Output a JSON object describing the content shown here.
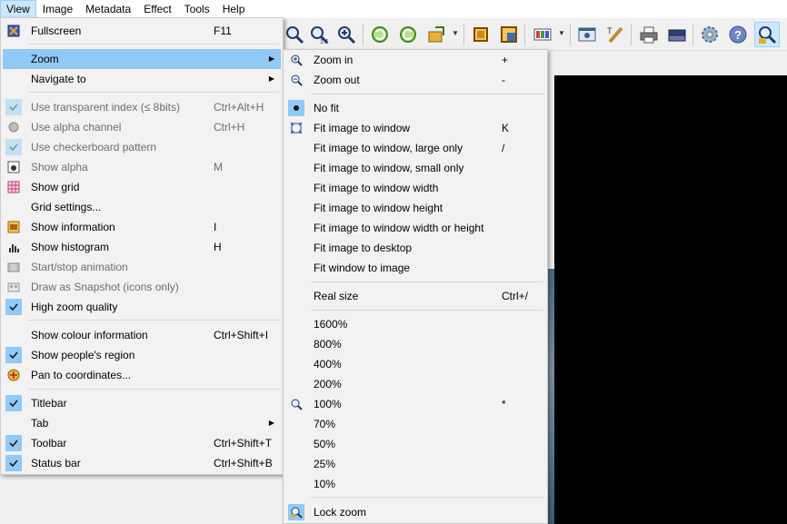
{
  "menubar": {
    "items": [
      "View",
      "Image",
      "Metadata",
      "Effect",
      "Tools",
      "Help"
    ]
  },
  "view_menu": {
    "items": [
      {
        "label": "Fullscreen",
        "shortcut": "F11",
        "icon": "fullscreen-icon"
      },
      {
        "label": "Zoom",
        "shortcut": "",
        "submenu": true
      },
      {
        "label": "Navigate to",
        "shortcut": "",
        "submenu": true
      },
      {
        "label": "Use transparent index (≤ 8bits)",
        "shortcut": "Ctrl+Alt+H",
        "checked": true,
        "disabled": true
      },
      {
        "label": "Use alpha channel",
        "shortcut": "Ctrl+H",
        "icon": "alpha-icon",
        "disabled": true
      },
      {
        "label": "Use checkerboard pattern",
        "shortcut": "",
        "checked": true,
        "disabled": true
      },
      {
        "label": "Show alpha",
        "shortcut": "M",
        "icon": "show-alpha-icon",
        "disabled": true
      },
      {
        "label": "Show grid",
        "shortcut": "",
        "icon": "grid-icon"
      },
      {
        "label": "Grid settings...",
        "shortcut": ""
      },
      {
        "label": "Show information",
        "shortcut": "I",
        "icon": "information-icon"
      },
      {
        "label": "Show histogram",
        "shortcut": "H",
        "icon": "histogram-icon"
      },
      {
        "label": "Start/stop animation",
        "shortcut": "",
        "icon": "animation-icon",
        "disabled": true
      },
      {
        "label": "Draw as Snapshot (icons only)",
        "shortcut": "",
        "icon": "snapshot-icon",
        "disabled": true
      },
      {
        "label": "High zoom quality",
        "shortcut": "",
        "checked": true
      },
      {
        "label": "Show colour information",
        "shortcut": "Ctrl+Shift+I"
      },
      {
        "label": "Show people's region",
        "shortcut": "",
        "checked": true
      },
      {
        "label": "Pan to coordinates...",
        "shortcut": "",
        "icon": "pan-icon"
      },
      {
        "label": "Titlebar",
        "shortcut": "",
        "checked": true
      },
      {
        "label": "Tab",
        "shortcut": "",
        "submenu": true
      },
      {
        "label": "Toolbar",
        "shortcut": "Ctrl+Shift+T",
        "checked": true
      },
      {
        "label": "Status bar",
        "shortcut": "Ctrl+Shift+B",
        "checked": true
      }
    ]
  },
  "zoom_menu": {
    "items": [
      {
        "label": "Zoom in",
        "shortcut": "+",
        "icon": "zoom-in-icon"
      },
      {
        "label": "Zoom out",
        "shortcut": "-",
        "icon": "zoom-out-icon"
      },
      {
        "label": "No fit",
        "shortcut": "",
        "radio": true
      },
      {
        "label": "Fit image to window",
        "shortcut": "K",
        "icon": "fit-window-icon"
      },
      {
        "label": "Fit image to window, large only",
        "shortcut": "/"
      },
      {
        "label": "Fit image to window, small only",
        "shortcut": ""
      },
      {
        "label": "Fit image to window width",
        "shortcut": ""
      },
      {
        "label": "Fit image to window height",
        "shortcut": ""
      },
      {
        "label": "Fit image to window width or height",
        "shortcut": ""
      },
      {
        "label": "Fit image to desktop",
        "shortcut": ""
      },
      {
        "label": "Fit window to image",
        "shortcut": ""
      },
      {
        "label": "Real size",
        "shortcut": "Ctrl+/"
      },
      {
        "label": "1600%",
        "shortcut": ""
      },
      {
        "label": "800%",
        "shortcut": ""
      },
      {
        "label": "400%",
        "shortcut": ""
      },
      {
        "label": "200%",
        "shortcut": ""
      },
      {
        "label": "100%",
        "shortcut": "*",
        "icon": "zoom-100-icon"
      },
      {
        "label": "70%",
        "shortcut": ""
      },
      {
        "label": "50%",
        "shortcut": ""
      },
      {
        "label": "25%",
        "shortcut": ""
      },
      {
        "label": "10%",
        "shortcut": ""
      },
      {
        "label": "Lock zoom",
        "shortcut": "",
        "icon": "lock-zoom-icon"
      }
    ]
  },
  "colors": {
    "highlight": "#91c9f7",
    "menu_bg": "#f2f2f2",
    "image_bg": "#000000"
  }
}
